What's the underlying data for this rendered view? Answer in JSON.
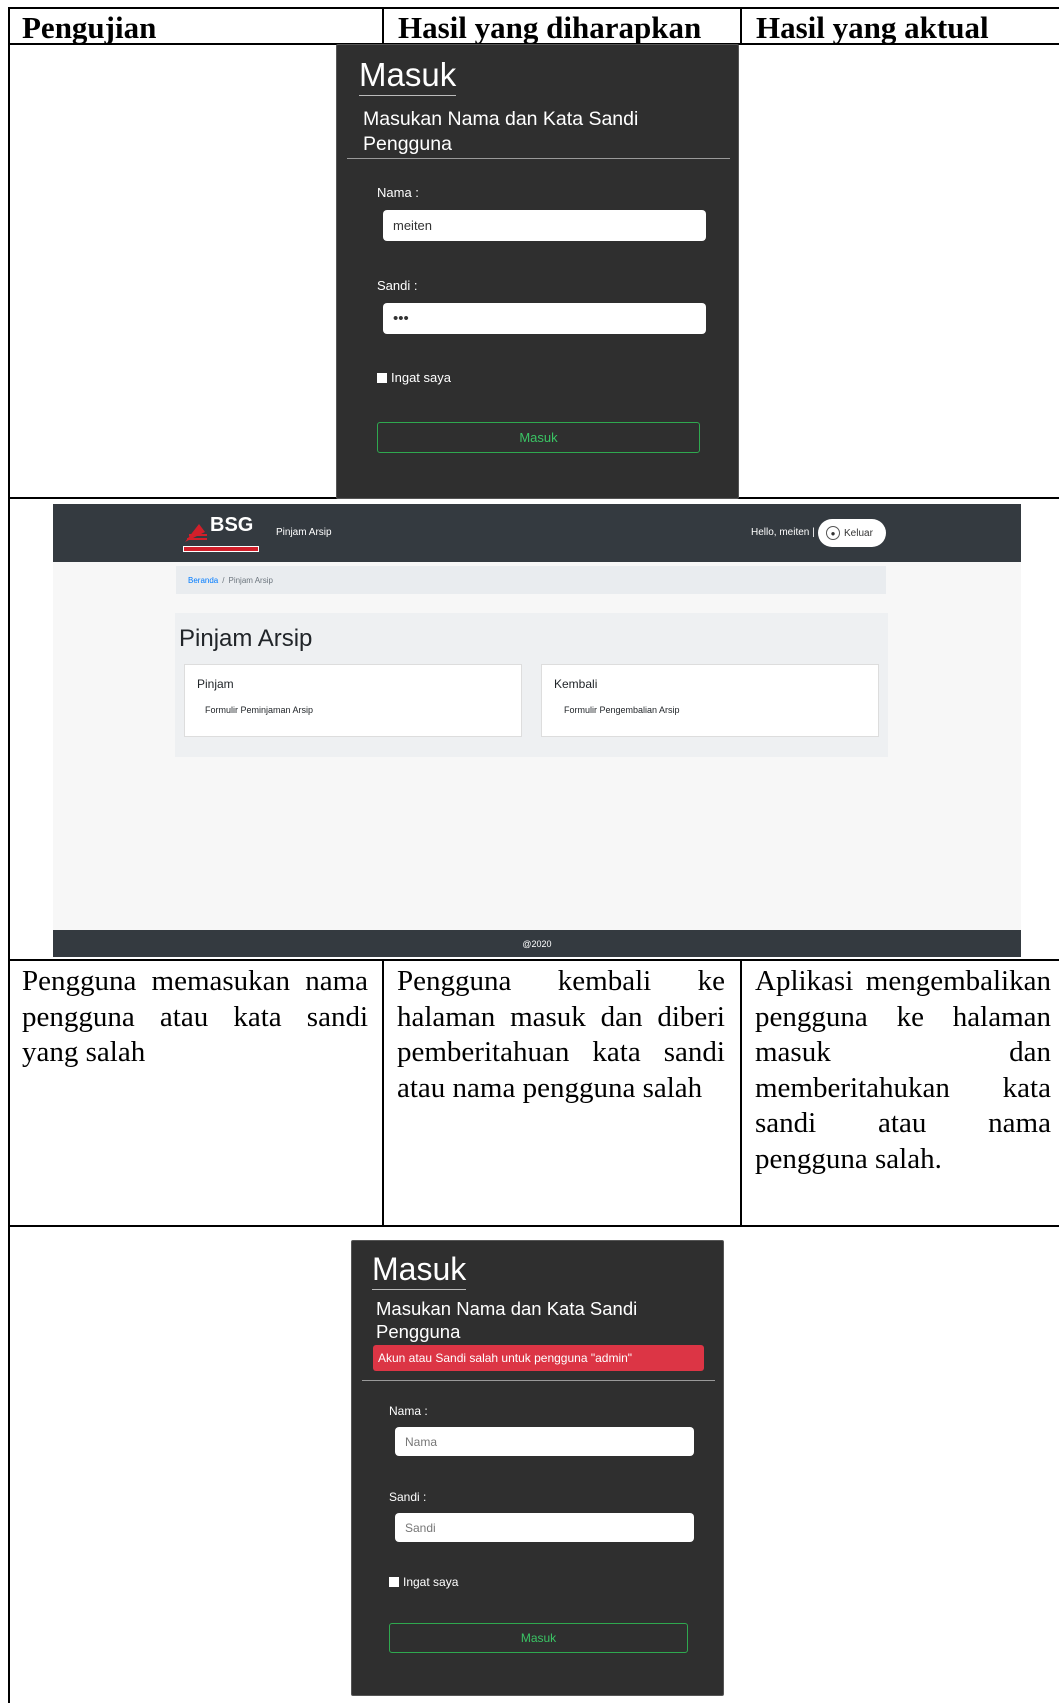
{
  "table": {
    "headers": [
      "Pengujian",
      "Hasil yang diharapkan",
      "Hasil yang aktual"
    ],
    "row": {
      "test": "Pengguna memasukan nama pengguna atau kata sandi yang salah",
      "expected": "Pengguna kembali ke halaman masuk dan diberi pemberitahuan kata sandi atau nama pengguna salah",
      "actual": "Aplikasi mengembalikan pengguna ke halaman masuk dan memberitahukan kata sandi atau nama pengguna salah."
    }
  },
  "login_filled": {
    "title": "Masuk",
    "subtitle": "Masukan Nama dan Kata Sandi Pengguna",
    "name_label": "Nama :",
    "name_value": "meiten",
    "password_label": "Sandi :",
    "password_value": "•••",
    "remember_label": "Ingat saya",
    "submit_label": "Masuk"
  },
  "app": {
    "brand": "BSG",
    "nav_title": "Pinjam Arsip",
    "greeting": "Hello, meiten |",
    "logout_label": "Keluar",
    "breadcrumb": {
      "home": "Beranda",
      "separator": "/",
      "current": "Pinjam Arsip"
    },
    "page_title": "Pinjam Arsip",
    "cards": [
      {
        "title": "Pinjam",
        "link": "Formulir Peminjaman Arsip"
      },
      {
        "title": "Kembali",
        "link": "Formulir Pengembalian Arsip"
      }
    ],
    "footer": "@2020"
  },
  "login_error": {
    "title": "Masuk",
    "subtitle": "Masukan Nama dan Kata Sandi Pengguna",
    "alert": "Akun atau Sandi salah untuk pengguna \"admin\"",
    "name_label": "Nama :",
    "name_placeholder": "Nama",
    "password_label": "Sandi :",
    "password_placeholder": "Sandi",
    "remember_label": "Ingat saya",
    "submit_label": "Masuk"
  },
  "colors": {
    "panel_bg": "#2f2f2f",
    "button_green": "#2fa84f",
    "alert_red": "#dc3545",
    "navbar": "#343a40"
  }
}
